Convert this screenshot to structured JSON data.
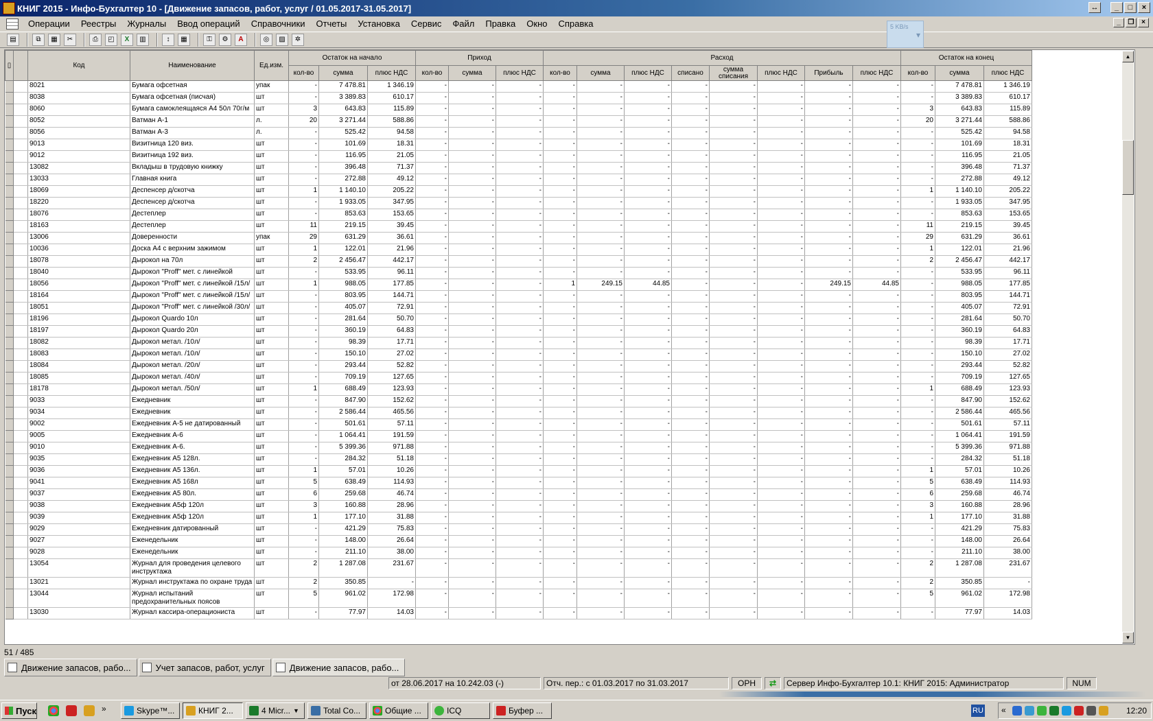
{
  "window": {
    "title": "КНИГ 2015 - Инфо-Бухгалтер 10 - [Движение запасов, работ, услуг / 01.05.2017-31.05.2017]"
  },
  "menu": [
    "Операции",
    "Реестры",
    "Журналы",
    "Ввод операций",
    "Справочники",
    "Отчеты",
    "Установка",
    "Сервис",
    "Файл",
    "Правка",
    "Окно",
    "Справка"
  ],
  "netspeed": "5 KB/s",
  "headers": {
    "code": "Код",
    "name": "Наименование",
    "unit": "Ед.изм.",
    "groups": {
      "opening": "Остаток на начало",
      "income": "Приход",
      "expense": "Расход",
      "closing": "Остаток на конец"
    },
    "qty": "кол-во",
    "sum": "сумма",
    "vat": "плюс НДС",
    "written_off": "списано",
    "written_sum": "сумма списания",
    "profit": "Прибыль"
  },
  "rows": [
    [
      "8021",
      "Бумага офсетная",
      "упак",
      "-",
      "7 478.81",
      "1 346.19",
      "-",
      "-",
      "-",
      "-",
      "-",
      "-",
      "-",
      "-",
      "-",
      "-",
      "-",
      "-",
      "7 478.81",
      "1 346.19"
    ],
    [
      "8038",
      "Бумага офсетная (писчая)",
      "шт",
      "-",
      "3 389.83",
      "610.17",
      "-",
      "-",
      "-",
      "-",
      "-",
      "-",
      "-",
      "-",
      "-",
      "-",
      "-",
      "-",
      "3 389.83",
      "610.17"
    ],
    [
      "8060",
      "Бумага самоклеящаяся А4 50л 70г/м",
      "шт",
      "3",
      "643.83",
      "115.89",
      "-",
      "-",
      "-",
      "-",
      "-",
      "-",
      "-",
      "-",
      "-",
      "-",
      "-",
      "3",
      "643.83",
      "115.89"
    ],
    [
      "8052",
      "Ватман А-1",
      "л.",
      "20",
      "3 271.44",
      "588.86",
      "-",
      "-",
      "-",
      "-",
      "-",
      "-",
      "-",
      "-",
      "-",
      "-",
      "-",
      "20",
      "3 271.44",
      "588.86"
    ],
    [
      "8056",
      "Ватман А-3",
      "л.",
      "-",
      "525.42",
      "94.58",
      "-",
      "-",
      "-",
      "-",
      "-",
      "-",
      "-",
      "-",
      "-",
      "-",
      "-",
      "-",
      "525.42",
      "94.58"
    ],
    [
      "9013",
      "Визитница 120 виз.",
      "шт",
      "-",
      "101.69",
      "18.31",
      "-",
      "-",
      "-",
      "-",
      "-",
      "-",
      "-",
      "-",
      "-",
      "-",
      "-",
      "-",
      "101.69",
      "18.31"
    ],
    [
      "9012",
      "Визитница 192 виз.",
      "шт",
      "-",
      "116.95",
      "21.05",
      "-",
      "-",
      "-",
      "-",
      "-",
      "-",
      "-",
      "-",
      "-",
      "-",
      "-",
      "-",
      "116.95",
      "21.05"
    ],
    [
      "13082",
      "Вкладыш в трудовую книжку",
      "шт",
      "-",
      "396.48",
      "71.37",
      "-",
      "-",
      "-",
      "-",
      "-",
      "-",
      "-",
      "-",
      "-",
      "-",
      "-",
      "-",
      "396.48",
      "71.37"
    ],
    [
      "13033",
      "Главная книга",
      "шт",
      "-",
      "272.88",
      "49.12",
      "-",
      "-",
      "-",
      "-",
      "-",
      "-",
      "-",
      "-",
      "-",
      "-",
      "-",
      "-",
      "272.88",
      "49.12"
    ],
    [
      "18069",
      "Деспенсер д/скотча",
      "шт",
      "1",
      "1 140.10",
      "205.22",
      "-",
      "-",
      "-",
      "-",
      "-",
      "-",
      "-",
      "-",
      "-",
      "-",
      "-",
      "1",
      "1 140.10",
      "205.22"
    ],
    [
      "18220",
      "Деспенсер д/скотча",
      "шт",
      "-",
      "1 933.05",
      "347.95",
      "-",
      "-",
      "-",
      "-",
      "-",
      "-",
      "-",
      "-",
      "-",
      "-",
      "-",
      "-",
      "1 933.05",
      "347.95"
    ],
    [
      "18076",
      "Дестеплер",
      "шт",
      "-",
      "853.63",
      "153.65",
      "-",
      "-",
      "-",
      "-",
      "-",
      "-",
      "-",
      "-",
      "-",
      "-",
      "-",
      "-",
      "853.63",
      "153.65"
    ],
    [
      "18163",
      "Дестеплер",
      "шт",
      "11",
      "219.15",
      "39.45",
      "-",
      "-",
      "-",
      "-",
      "-",
      "-",
      "-",
      "-",
      "-",
      "-",
      "-",
      "11",
      "219.15",
      "39.45"
    ],
    [
      "13006",
      "Доверенности",
      "упак",
      "29",
      "631.29",
      "36.61",
      "-",
      "-",
      "-",
      "-",
      "-",
      "-",
      "-",
      "-",
      "-",
      "-",
      "-",
      "29",
      "631.29",
      "36.61"
    ],
    [
      "10036",
      "Доска А4 с верхним зажимом",
      "шт",
      "1",
      "122.01",
      "21.96",
      "-",
      "-",
      "-",
      "-",
      "-",
      "-",
      "-",
      "-",
      "-",
      "-",
      "-",
      "1",
      "122.01",
      "21.96"
    ],
    [
      "18078",
      "Дырокол на 70л",
      "шт",
      "2",
      "2 456.47",
      "442.17",
      "-",
      "-",
      "-",
      "-",
      "-",
      "-",
      "-",
      "-",
      "-",
      "-",
      "-",
      "2",
      "2 456.47",
      "442.17"
    ],
    [
      "18040",
      "Дырокол \"Proff\" мет. с линейкой",
      "шт",
      "-",
      "533.95",
      "96.11",
      "-",
      "-",
      "-",
      "-",
      "-",
      "-",
      "-",
      "-",
      "-",
      "-",
      "-",
      "-",
      "533.95",
      "96.11"
    ],
    [
      "18056",
      "Дырокол \"Proff\" мет. с линейкой /15л/",
      "шт",
      "1",
      "988.05",
      "177.85",
      "-",
      "-",
      "-",
      "1",
      "249.15",
      "44.85",
      "-",
      "-",
      "-",
      "249.15",
      "44.85",
      "-",
      "988.05",
      "177.85"
    ],
    [
      "18164",
      "Дырокол \"Proff\" мет. с линейкой /15л/",
      "шт",
      "-",
      "803.95",
      "144.71",
      "-",
      "-",
      "-",
      "-",
      "-",
      "-",
      "-",
      "-",
      "-",
      "-",
      "-",
      "-",
      "803.95",
      "144.71"
    ],
    [
      "18051",
      "Дырокол \"Proff\" мет. с линейкой /30л/",
      "шт",
      "-",
      "405.07",
      "72.91",
      "-",
      "-",
      "-",
      "-",
      "-",
      "-",
      "-",
      "-",
      "-",
      "-",
      "-",
      "-",
      "405.07",
      "72.91"
    ],
    [
      "18196",
      "Дырокол Quardo 10л",
      "шт",
      "-",
      "281.64",
      "50.70",
      "-",
      "-",
      "-",
      "-",
      "-",
      "-",
      "-",
      "-",
      "-",
      "-",
      "-",
      "-",
      "281.64",
      "50.70"
    ],
    [
      "18197",
      "Дырокол Quardo 20л",
      "шт",
      "-",
      "360.19",
      "64.83",
      "-",
      "-",
      "-",
      "-",
      "-",
      "-",
      "-",
      "-",
      "-",
      "-",
      "-",
      "-",
      "360.19",
      "64.83"
    ],
    [
      "18082",
      "Дырокол метал. /10л/",
      "шт",
      "-",
      "98.39",
      "17.71",
      "-",
      "-",
      "-",
      "-",
      "-",
      "-",
      "-",
      "-",
      "-",
      "-",
      "-",
      "-",
      "98.39",
      "17.71"
    ],
    [
      "18083",
      "Дырокол метал. /10л/",
      "шт",
      "-",
      "150.10",
      "27.02",
      "-",
      "-",
      "-",
      "-",
      "-",
      "-",
      "-",
      "-",
      "-",
      "-",
      "-",
      "-",
      "150.10",
      "27.02"
    ],
    [
      "18084",
      "Дырокол метал. /20л/",
      "шт",
      "-",
      "293.44",
      "52.82",
      "-",
      "-",
      "-",
      "-",
      "-",
      "-",
      "-",
      "-",
      "-",
      "-",
      "-",
      "-",
      "293.44",
      "52.82"
    ],
    [
      "18085",
      "Дырокол метал. /40л/",
      "шт",
      "-",
      "709.19",
      "127.65",
      "-",
      "-",
      "-",
      "-",
      "-",
      "-",
      "-",
      "-",
      "-",
      "-",
      "-",
      "-",
      "709.19",
      "127.65"
    ],
    [
      "18178",
      "Дырокол метал. /50л/",
      "шт",
      "1",
      "688.49",
      "123.93",
      "-",
      "-",
      "-",
      "-",
      "-",
      "-",
      "-",
      "-",
      "-",
      "-",
      "-",
      "1",
      "688.49",
      "123.93"
    ],
    [
      "9033",
      "Ежедневник",
      "шт",
      "-",
      "847.90",
      "152.62",
      "-",
      "-",
      "-",
      "-",
      "-",
      "-",
      "-",
      "-",
      "-",
      "-",
      "-",
      "-",
      "847.90",
      "152.62"
    ],
    [
      "9034",
      "Ежедневник",
      "шт",
      "-",
      "2 586.44",
      "465.56",
      "-",
      "-",
      "-",
      "-",
      "-",
      "-",
      "-",
      "-",
      "-",
      "-",
      "-",
      "-",
      "2 586.44",
      "465.56"
    ],
    [
      "9002",
      "Ежедневник А-5 не датированный",
      "шт",
      "-",
      "501.61",
      "57.11",
      "-",
      "-",
      "-",
      "-",
      "-",
      "-",
      "-",
      "-",
      "-",
      "-",
      "-",
      "-",
      "501.61",
      "57.11"
    ],
    [
      "9005",
      "Ежедневник А-6",
      "шт",
      "-",
      "1 064.41",
      "191.59",
      "-",
      "-",
      "-",
      "-",
      "-",
      "-",
      "-",
      "-",
      "-",
      "-",
      "-",
      "-",
      "1 064.41",
      "191.59"
    ],
    [
      "9010",
      "Ежедневник А-6.",
      "шт",
      "-",
      "5 399.36",
      "971.88",
      "-",
      "-",
      "-",
      "-",
      "-",
      "-",
      "-",
      "-",
      "-",
      "-",
      "-",
      "-",
      "5 399.36",
      "971.88"
    ],
    [
      "9035",
      "Ежедневник А5 128л.",
      "шт",
      "-",
      "284.32",
      "51.18",
      "-",
      "-",
      "-",
      "-",
      "-",
      "-",
      "-",
      "-",
      "-",
      "-",
      "-",
      "-",
      "284.32",
      "51.18"
    ],
    [
      "9036",
      "Ежедневник А5 136л.",
      "шт",
      "1",
      "57.01",
      "10.26",
      "-",
      "-",
      "-",
      "-",
      "-",
      "-",
      "-",
      "-",
      "-",
      "-",
      "-",
      "1",
      "57.01",
      "10.26"
    ],
    [
      "9041",
      "Ежедневник А5 168л",
      "шт",
      "5",
      "638.49",
      "114.93",
      "-",
      "-",
      "-",
      "-",
      "-",
      "-",
      "-",
      "-",
      "-",
      "-",
      "-",
      "5",
      "638.49",
      "114.93"
    ],
    [
      "9037",
      "Ежедневник А5 80л.",
      "шт",
      "6",
      "259.68",
      "46.74",
      "-",
      "-",
      "-",
      "-",
      "-",
      "-",
      "-",
      "-",
      "-",
      "-",
      "-",
      "6",
      "259.68",
      "46.74"
    ],
    [
      "9038",
      "Ежедневник А5ф 120л",
      "шт",
      "3",
      "160.88",
      "28.96",
      "-",
      "-",
      "-",
      "-",
      "-",
      "-",
      "-",
      "-",
      "-",
      "-",
      "-",
      "3",
      "160.88",
      "28.96"
    ],
    [
      "9039",
      "Ежедневник А5ф 120л",
      "шт",
      "1",
      "177.10",
      "31.88",
      "-",
      "-",
      "-",
      "-",
      "-",
      "-",
      "-",
      "-",
      "-",
      "-",
      "-",
      "1",
      "177.10",
      "31.88"
    ],
    [
      "9029",
      "Ежедневник датированный",
      "шт",
      "-",
      "421.29",
      "75.83",
      "-",
      "-",
      "-",
      "-",
      "-",
      "-",
      "-",
      "-",
      "-",
      "-",
      "-",
      "-",
      "421.29",
      "75.83"
    ],
    [
      "9027",
      "Еженедельник",
      "шт",
      "-",
      "148.00",
      "26.64",
      "-",
      "-",
      "-",
      "-",
      "-",
      "-",
      "-",
      "-",
      "-",
      "-",
      "-",
      "-",
      "148.00",
      "26.64"
    ],
    [
      "9028",
      "Еженедельник",
      "шт",
      "-",
      "211.10",
      "38.00",
      "-",
      "-",
      "-",
      "-",
      "-",
      "-",
      "-",
      "-",
      "-",
      "-",
      "-",
      "-",
      "211.10",
      "38.00"
    ],
    [
      "13054",
      "Журнал для проведения целевого инструктажа",
      "шт",
      "2",
      "1 287.08",
      "231.67",
      "-",
      "-",
      "-",
      "-",
      "-",
      "-",
      "-",
      "-",
      "-",
      "-",
      "-",
      "2",
      "1 287.08",
      "231.67"
    ],
    [
      "13021",
      "Журнал инструктажа по охране труда",
      "шт",
      "2",
      "350.85",
      "-",
      "-",
      "-",
      "-",
      "-",
      "-",
      "-",
      "-",
      "-",
      "-",
      "-",
      "-",
      "2",
      "350.85",
      "-"
    ],
    [
      "13044",
      "Журнал испытаний предохранительных поясов",
      "шт",
      "5",
      "961.02",
      "172.98",
      "-",
      "-",
      "-",
      "-",
      "-",
      "-",
      "-",
      "-",
      "-",
      "-",
      "-",
      "5",
      "961.02",
      "172.98"
    ],
    [
      "13030",
      "Журнал кассира-операциониста",
      "шт",
      "-",
      "77.97",
      "14.03",
      "-",
      "-",
      "-",
      "-",
      "-",
      "-",
      "-",
      "-",
      "-",
      "-",
      "-",
      "-",
      "77.97",
      "14.03"
    ]
  ],
  "counter": "51 / 485",
  "mdi_tabs": [
    "Движение запасов, рабо...",
    "Учет запасов, работ, услуг",
    "Движение запасов, рабо..."
  ],
  "status": {
    "date": "от 28.06.2017 на 10.242.03 (-)",
    "period": "Отч. пер.: с 01.03.2017 по 31.03.2017",
    "mode": "ОРН",
    "server": "Сервер Инфо-Бухгалтер 10.1: КНИГ 2015: Администратор",
    "num": "NUM"
  },
  "taskbar": {
    "start": "Пуск",
    "tasks": [
      "Skype™...",
      "КНИГ 2...",
      "4 Micr...",
      "Total Co...",
      "Общие ...",
      "ICQ",
      "Буфер ..."
    ],
    "lang": "RU",
    "clock": "12:20"
  },
  "colors": {
    "titlebar": "#0a246a",
    "chrome": "#d4d0c8"
  }
}
